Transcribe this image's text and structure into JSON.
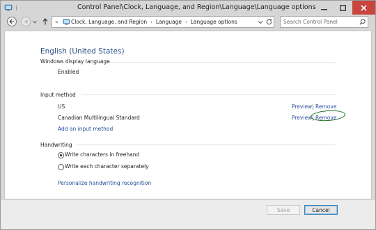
{
  "window": {
    "title": "Control Panel\\Clock, Language, and Region\\Language\\Language options"
  },
  "addressbar": {
    "prefix": "«",
    "crumbs": [
      {
        "label": "Clock, Language, and Region"
      },
      {
        "label": "Language"
      },
      {
        "label": "Language options"
      }
    ]
  },
  "search": {
    "placeholder": "Search Control Panel"
  },
  "content": {
    "heading": "English (United States)",
    "display_language": {
      "label": "Windows display language",
      "value": "Enabled"
    },
    "input_method": {
      "label": "Input method",
      "items": [
        {
          "name": "US",
          "preview": "Preview",
          "separator": "|",
          "remove": "Remove"
        },
        {
          "name": "Canadian Multilingual Standard",
          "preview": "Preview",
          "separator": "|",
          "remove": "Remove"
        }
      ],
      "add_link": "Add an input method"
    },
    "handwriting": {
      "label": "Handwriting",
      "options": [
        {
          "label": "Write characters in freehand",
          "checked": true
        },
        {
          "label": "Write each character separately",
          "checked": false
        }
      ],
      "personalize_link": "Personalize handwriting recognition"
    }
  },
  "footer": {
    "save_label": "Save",
    "cancel_label": "Cancel"
  },
  "colors": {
    "heading": "#2a4e86",
    "link": "#2a4e9e",
    "close_button": "#c7463d",
    "annotation": "#1d6b1d"
  },
  "icons": {
    "title": "control-panel-icon",
    "back": "arrow-left-icon",
    "forward": "arrow-right-icon",
    "up": "arrow-up-icon",
    "address": "control-panel-icon",
    "refresh": "refresh-icon",
    "search": "search-icon"
  }
}
